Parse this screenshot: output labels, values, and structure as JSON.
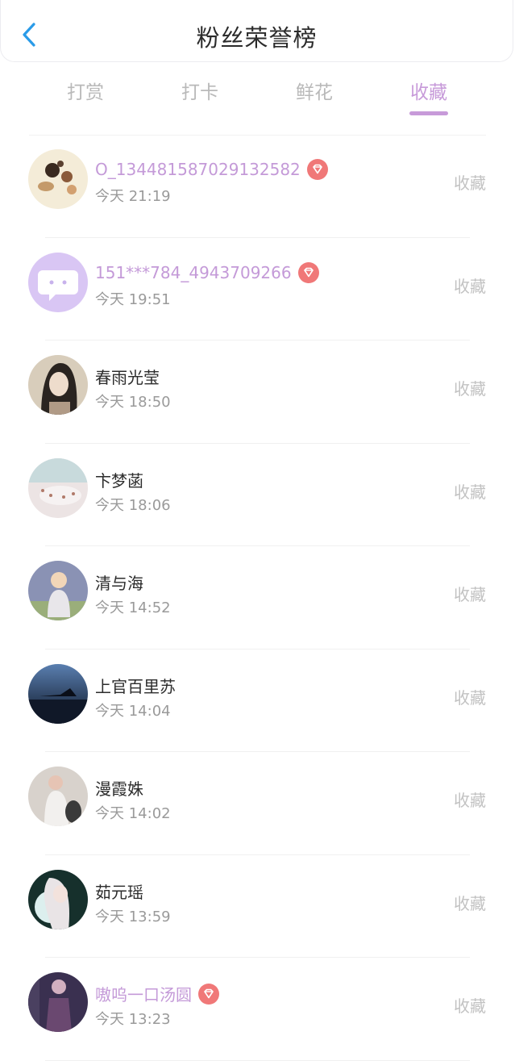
{
  "header": {
    "title": "粉丝荣誉榜"
  },
  "tabs": [
    {
      "label": "打赏"
    },
    {
      "label": "打卡"
    },
    {
      "label": "鲜花"
    },
    {
      "label": "收藏"
    }
  ],
  "active_tab": "收藏",
  "fans": [
    {
      "name": "O_134481587029132582",
      "time": "今天 21:19",
      "action": "收藏",
      "vip": true
    },
    {
      "name": "151***784_4943709266",
      "time": "今天 19:51",
      "action": "收藏",
      "vip": true
    },
    {
      "name": "春雨光莹",
      "time": "今天 18:50",
      "action": "收藏",
      "vip": false
    },
    {
      "name": "卞梦菡",
      "time": "今天 18:06",
      "action": "收藏",
      "vip": false
    },
    {
      "name": "清与海",
      "time": "今天 14:52",
      "action": "收藏",
      "vip": false
    },
    {
      "name": "上官百里苏",
      "time": "今天 14:04",
      "action": "收藏",
      "vip": false
    },
    {
      "name": "漫霞姝",
      "time": "今天 14:02",
      "action": "收藏",
      "vip": false
    },
    {
      "name": "茹元瑶",
      "time": "今天 13:59",
      "action": "收藏",
      "vip": false
    },
    {
      "name": "嗷呜一口汤圆",
      "time": "今天 13:23",
      "action": "收藏",
      "vip": true
    }
  ],
  "colors": {
    "accent": "#c79ad9",
    "back": "#2a9be8",
    "vip_badge": "#f07878"
  }
}
